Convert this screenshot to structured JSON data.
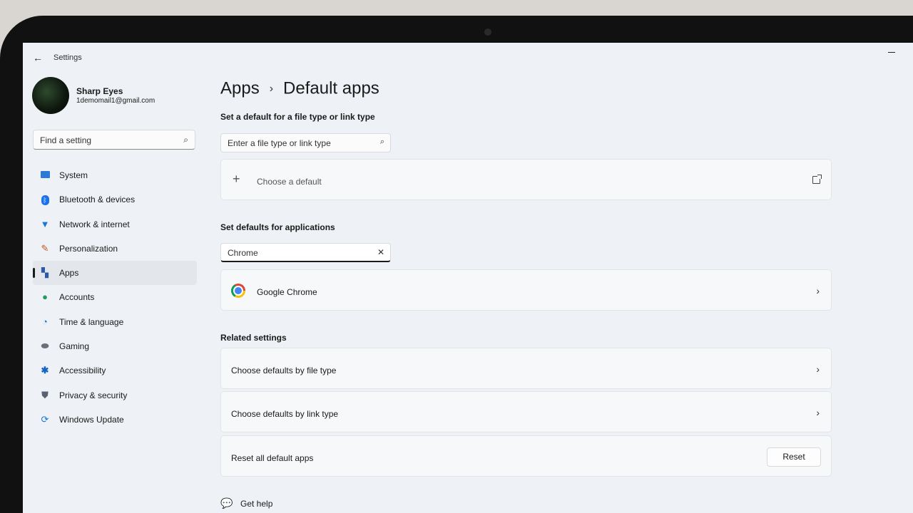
{
  "window": {
    "title": "Settings"
  },
  "profile": {
    "name": "Sharp Eyes",
    "email": "1demomail1@gmail.com"
  },
  "sidebar": {
    "search_placeholder": "Find a setting",
    "items": [
      {
        "label": "System",
        "icon": "monitor-icon",
        "color": "#2b7bd6"
      },
      {
        "label": "Bluetooth & devices",
        "icon": "bluetooth-icon",
        "color": "#1a73e8"
      },
      {
        "label": "Network & internet",
        "icon": "wifi-icon",
        "color": "#1877d6"
      },
      {
        "label": "Personalization",
        "icon": "brush-icon",
        "color": "#c05a2a"
      },
      {
        "label": "Apps",
        "icon": "apps-icon",
        "color": "#2a5aa8",
        "active": true
      },
      {
        "label": "Accounts",
        "icon": "person-icon",
        "color": "#1e9e5a"
      },
      {
        "label": "Time & language",
        "icon": "globe-clock-icon",
        "color": "#1f7ac4"
      },
      {
        "label": "Gaming",
        "icon": "gamepad-icon",
        "color": "#6b6f7a"
      },
      {
        "label": "Accessibility",
        "icon": "accessibility-icon",
        "color": "#1565c0"
      },
      {
        "label": "Privacy & security",
        "icon": "shield-icon",
        "color": "#5a6170"
      },
      {
        "label": "Windows Update",
        "icon": "update-icon",
        "color": "#1976d2"
      }
    ]
  },
  "breadcrumb": {
    "parent": "Apps",
    "separator": "›",
    "current": "Default apps"
  },
  "file_type": {
    "heading": "Set a default for a file type or link type",
    "search_placeholder": "Enter a file type or link type",
    "choose_label": "Choose a default"
  },
  "applications": {
    "heading": "Set defaults for applications",
    "search_value": "Chrome",
    "results": [
      {
        "label": "Google Chrome"
      }
    ]
  },
  "related": {
    "heading": "Related settings",
    "by_file_type": "Choose defaults by file type",
    "by_link_type": "Choose defaults by link type",
    "reset_label": "Reset all default apps",
    "reset_button": "Reset"
  },
  "help": {
    "label": "Get help"
  }
}
